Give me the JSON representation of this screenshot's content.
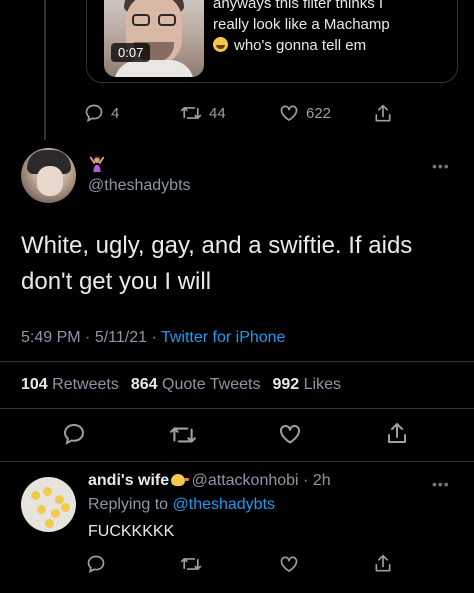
{
  "colors": {
    "background": "#000000",
    "text_primary": "#e7e9ea",
    "text_secondary": "#8b98a5",
    "link": "#1d9bf0",
    "divider": "#2f3336"
  },
  "quoted": {
    "video_duration": "0:07",
    "text_lines": [
      "anyways this filter thinks I",
      "really look like a Machamp",
      "who's gonna tell em"
    ],
    "emoji": "crying-face-emoji",
    "actions": {
      "replies": "4",
      "retweets": "44",
      "likes": "622"
    }
  },
  "tweet": {
    "display_name_emoji": "person-gesturing-emoji",
    "handle": "@theshadybts",
    "text_line1": "White, ugly, gay, and a swiftie. If aids",
    "text_line2": "don't get you I will",
    "time": "5:49 PM",
    "date": "5/11/21",
    "sep": " · ",
    "source": "Twitter for iPhone",
    "stats": {
      "retweets_count": "104",
      "retweets_label": "Retweets",
      "quotes_count": "864",
      "quotes_label": "Quote Tweets",
      "likes_count": "992",
      "likes_label": "Likes"
    }
  },
  "reply": {
    "name": "andi's wife",
    "name_emoji": "duck-emoji",
    "handle": "@attackonhobi",
    "sep": " · ",
    "age": "2h",
    "replying_prefix": "Replying to",
    "replying_handle": "@theshadybts",
    "text": "FUCKKKKK"
  },
  "icons": [
    "reply-icon",
    "retweet-icon",
    "like-icon",
    "share-icon",
    "more-icon"
  ]
}
